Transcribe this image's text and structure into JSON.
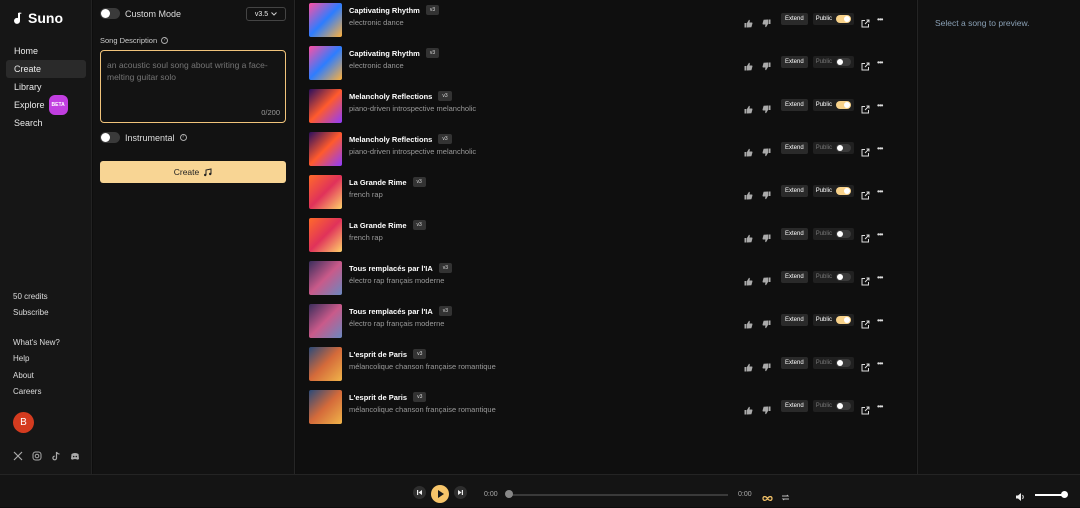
{
  "app": {
    "name": "Suno"
  },
  "nav": {
    "home": "Home",
    "create": "Create",
    "library": "Library",
    "explore": "Explore",
    "explore_badge": "BETA",
    "search": "Search"
  },
  "account": {
    "credits": "50 credits",
    "subscribe": "Subscribe",
    "avatar_initial": "B"
  },
  "footer_links": {
    "whats_new": "What's New?",
    "help": "Help",
    "about": "About",
    "careers": "Careers"
  },
  "socials": [
    "x-icon",
    "instagram-icon",
    "tiktok-icon",
    "discord-icon"
  ],
  "create_panel": {
    "custom_mode_label": "Custom Mode",
    "custom_mode_on": false,
    "model_version": "v3.5",
    "description_label": "Song Description",
    "description_placeholder": "an acoustic soul song about writing a face-melting guitar solo",
    "description_value": "",
    "char_counter": "0/200",
    "instrumental_label": "Instrumental",
    "instrumental_on": false,
    "create_button": "Create"
  },
  "songs": [
    {
      "title": "Captivating Rhythm",
      "version": "v3",
      "genre": "electronic dance",
      "extend": "Extend",
      "visibility": "Public",
      "public": true
    },
    {
      "title": "Captivating Rhythm",
      "version": "v3",
      "genre": "electronic dance",
      "extend": "Extend",
      "visibility": "Public",
      "public": false
    },
    {
      "title": "Melancholy Reflections",
      "version": "v3",
      "genre": "piano-driven introspective melancholic",
      "extend": "Extend",
      "visibility": "Public",
      "public": true
    },
    {
      "title": "Melancholy Reflections",
      "version": "v3",
      "genre": "piano-driven introspective melancholic",
      "extend": "Extend",
      "visibility": "Public",
      "public": false
    },
    {
      "title": "La Grande Rime",
      "version": "v3",
      "genre": "french rap",
      "extend": "Extend",
      "visibility": "Public",
      "public": true
    },
    {
      "title": "La Grande Rime",
      "version": "v3",
      "genre": "french rap",
      "extend": "Extend",
      "visibility": "Public",
      "public": false
    },
    {
      "title": "Tous remplacés par l'IA",
      "version": "v3",
      "genre": "électro rap français moderne",
      "extend": "Extend",
      "visibility": "Public",
      "public": false
    },
    {
      "title": "Tous remplacés par l'IA",
      "version": "v3",
      "genre": "électro rap français moderne",
      "extend": "Extend",
      "visibility": "Public",
      "public": true
    },
    {
      "title": "L'esprit de Paris",
      "version": "v3",
      "genre": "mélancolique chanson française romantique",
      "extend": "Extend",
      "visibility": "Public",
      "public": false
    },
    {
      "title": "L'esprit de Paris",
      "version": "v3",
      "genre": "mélancolique chanson française romantique",
      "extend": "Extend",
      "visibility": "Public",
      "public": false
    }
  ],
  "preview": {
    "empty_text": "Select a song to preview."
  },
  "player": {
    "current_time": "0:00",
    "duration": "0:00",
    "progress": 0,
    "volume": 0.9
  },
  "colors": {
    "accent": "#f8d594",
    "public_toggle_on": "#f8d28a",
    "beta_badge": "#c13ee0",
    "avatar": "#d43b1f"
  }
}
